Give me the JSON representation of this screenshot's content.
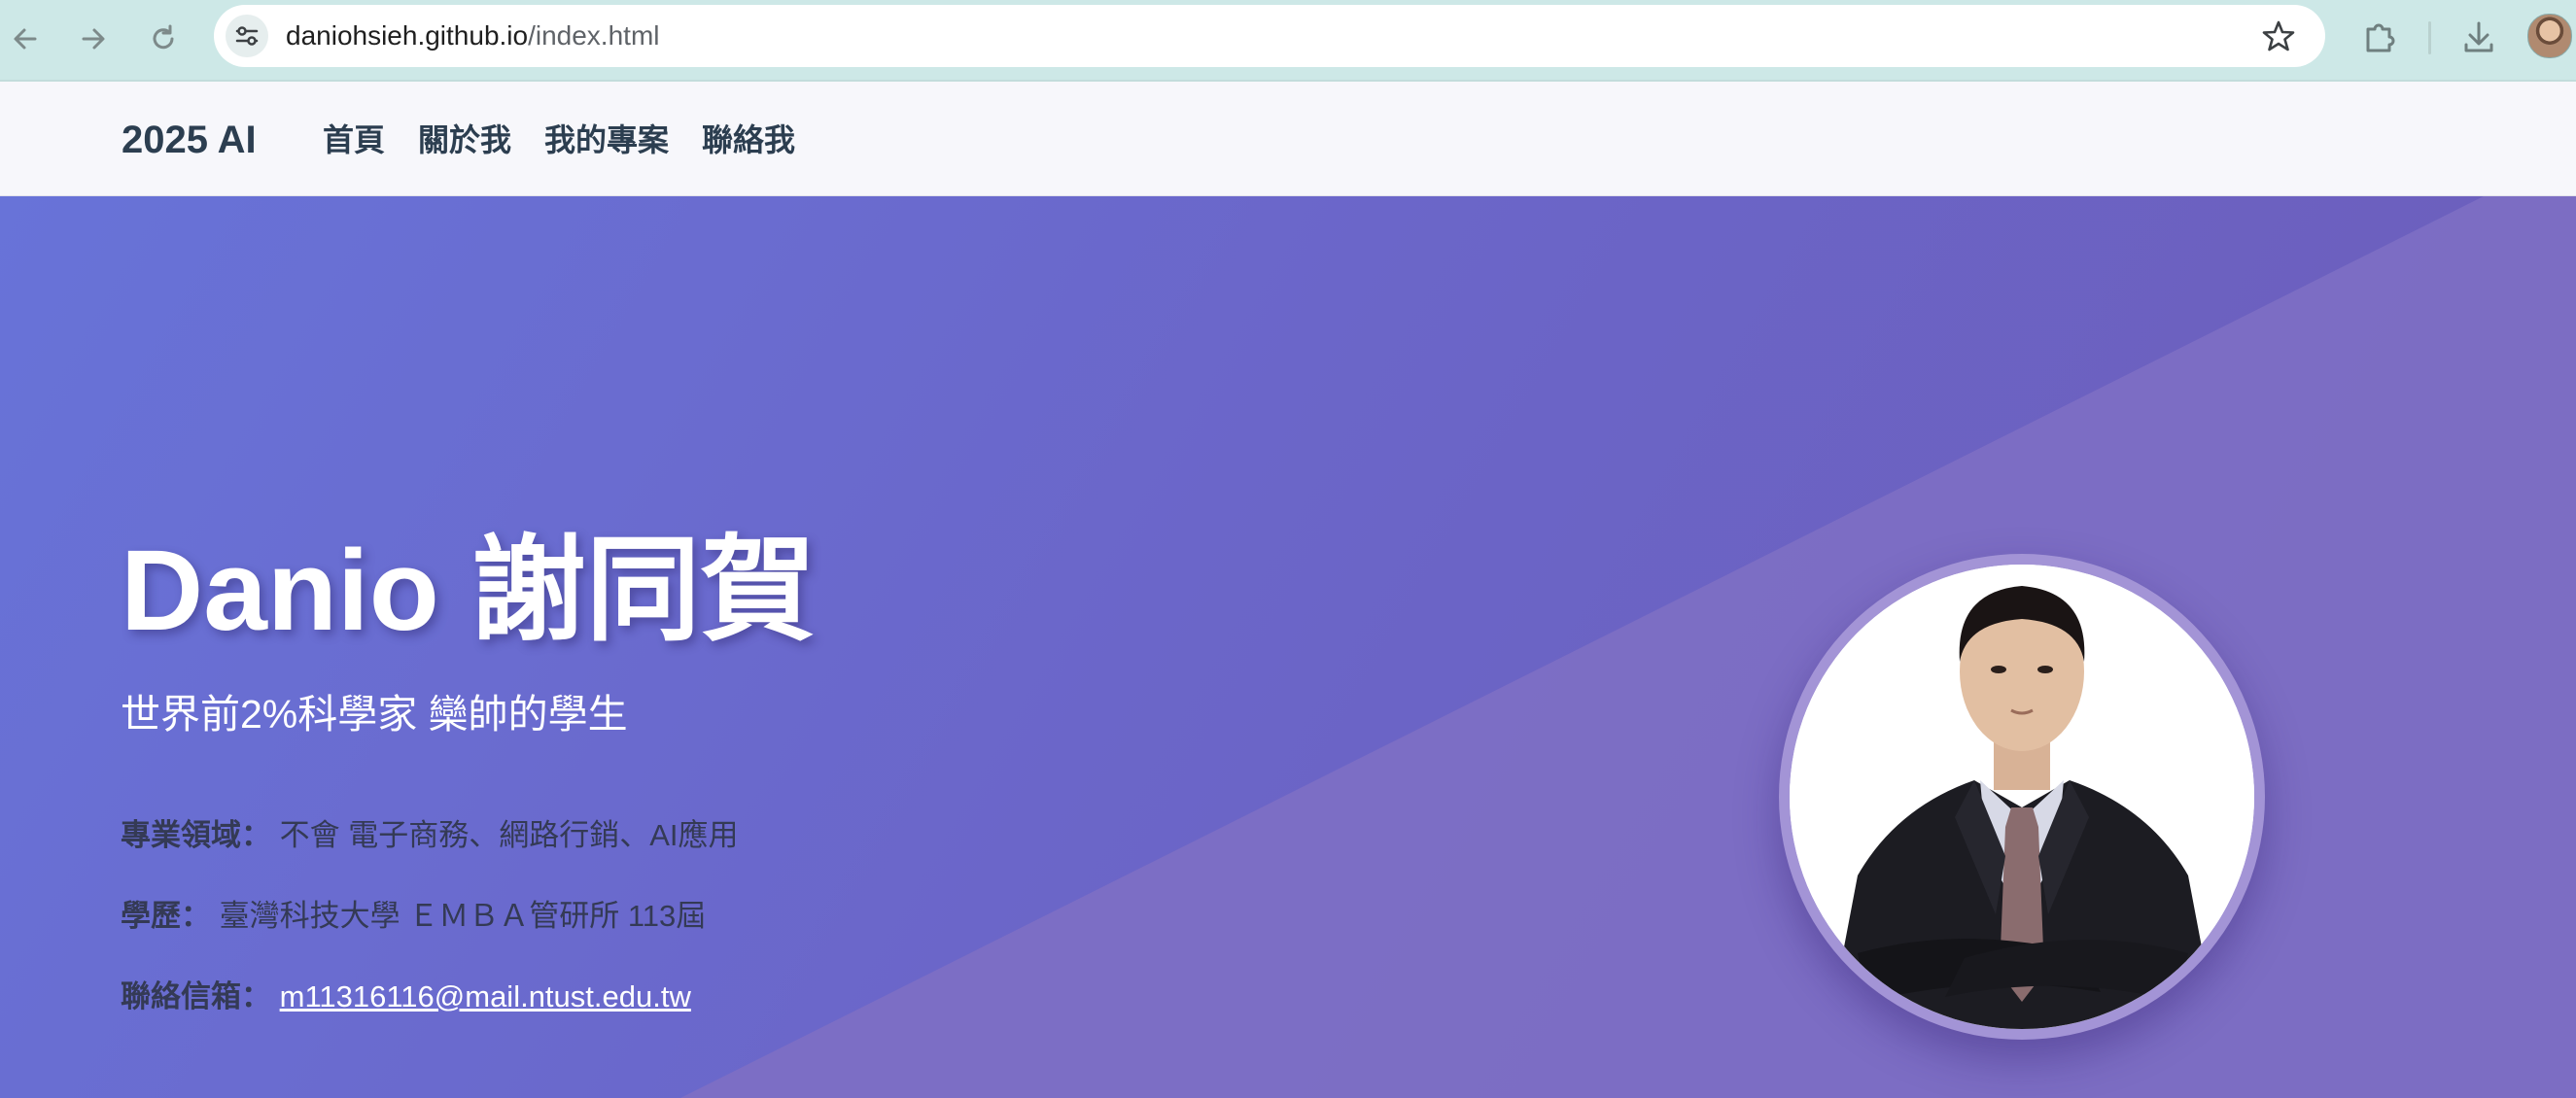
{
  "browser": {
    "url_host": "daniohsieh.github.io",
    "url_path": "/index.html",
    "icons": [
      "back-arrow-icon",
      "forward-arrow-icon",
      "reload-icon",
      "site-info-icon",
      "star-icon",
      "extensions-icon",
      "download-icon"
    ]
  },
  "header": {
    "brand": "2025 AI",
    "nav": [
      {
        "label": "首頁"
      },
      {
        "label": "關於我"
      },
      {
        "label": "我的專案"
      },
      {
        "label": "聯絡我"
      }
    ]
  },
  "hero": {
    "name": "Danio 謝同賀",
    "subtitle": "世界前2%科學家 欒帥的學生",
    "info": {
      "field_label": "專業領域：",
      "field_value": "不會 電子商務、網路行銷、AI應用",
      "edu_label": "學歷：",
      "edu_value": "臺灣科技大學 ＥＭＢＡ管研所 113屆",
      "email_label": "聯絡信箱：",
      "email_value": "m11316116@mail.ntust.edu.tw"
    }
  },
  "colors": {
    "chrome_bg": "#cde8e7",
    "header_text": "#2c3e50",
    "hero_gradient_start": "#6873d8",
    "hero_gradient_end": "#6c5cb8",
    "hero_light_triangle": "#7f70c4",
    "photo_ring": "#a394d6"
  }
}
